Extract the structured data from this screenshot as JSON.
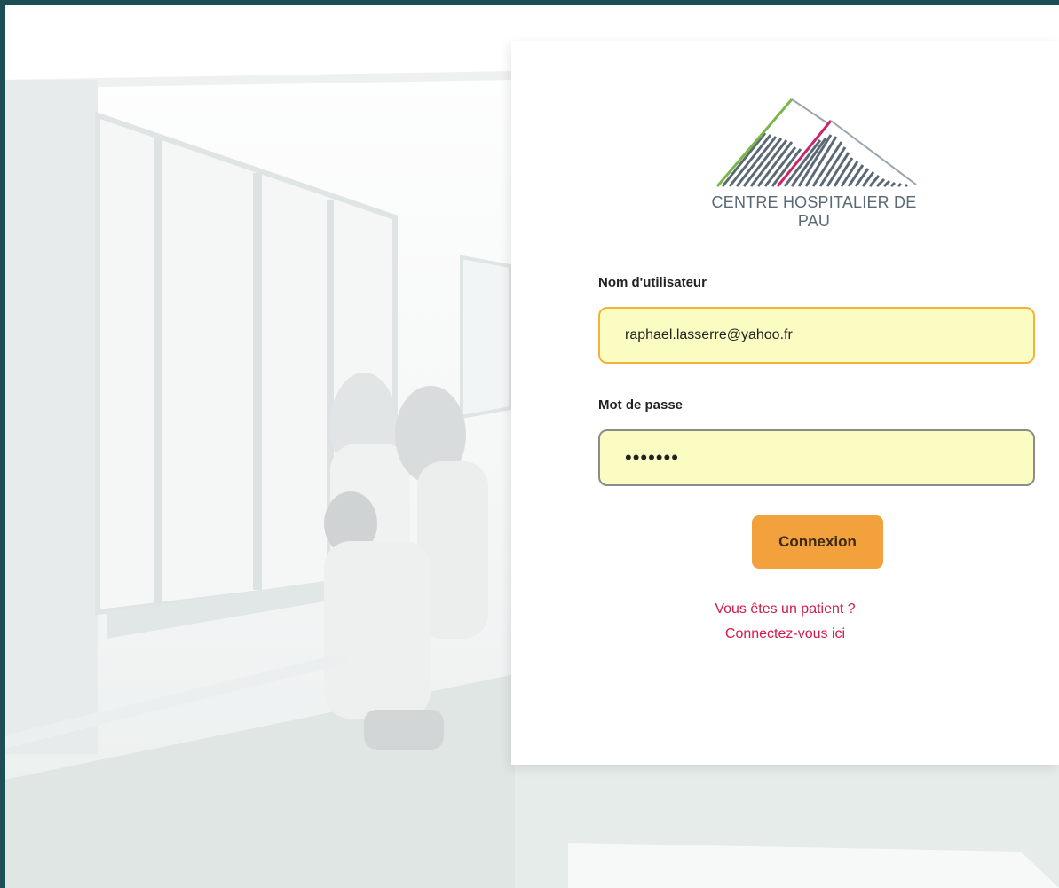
{
  "logo": {
    "name": "CENTRE HOSPITALIER DE PAU"
  },
  "login": {
    "username_label": "Nom d'utilisateur",
    "username_value": "raphael.lasserre@yahoo.fr",
    "password_label": "Mot de passe",
    "password_value": "•••••••",
    "submit_label": "Connexion",
    "patient_question": "Vous êtes un patient ?",
    "patient_link": "Connectez-vous ici"
  },
  "colors": {
    "frame": "#1e4e55",
    "input_bg": "#fafcc2",
    "input_focus_border": "#f3b33a",
    "button": "#f2a13d",
    "link": "#d41b47",
    "logo_green": "#7ab648",
    "logo_magenta": "#d0236a",
    "logo_grey": "#5b6876"
  }
}
